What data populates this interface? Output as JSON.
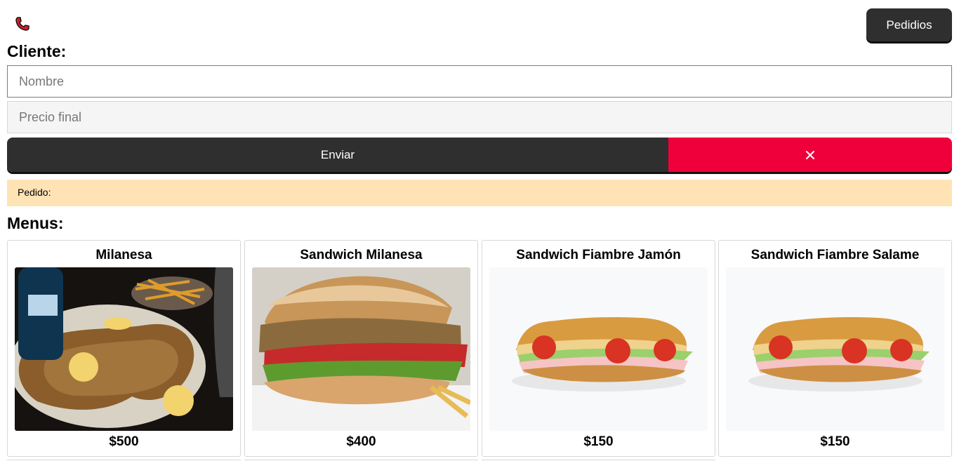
{
  "header": {
    "phone_icon": "phone-icon",
    "orders_label": "Pedidios"
  },
  "client": {
    "title": "Cliente:",
    "name_placeholder": "Nombre",
    "price_placeholder": "Precio final",
    "send_label": "Enviar",
    "clear_icon": "close-icon",
    "order_label": "Pedido:"
  },
  "menu": {
    "title": "Menus:",
    "items": [
      {
        "name": "Milanesa",
        "price": "$500",
        "image": "milanesa-photo"
      },
      {
        "name": "Sandwich Milanesa",
        "price": "$400",
        "image": "milanesa-sandwich-photo"
      },
      {
        "name": "Sandwich Fiambre Jamón",
        "price": "$150",
        "image": "ham-sandwich-photo"
      },
      {
        "name": "Sandwich Fiambre Salame",
        "price": "$150",
        "image": "salami-sandwich-photo"
      }
    ]
  },
  "colors": {
    "dark_button": "#2f2f2f",
    "danger": "#f0003a",
    "order_bar": "#ffe3b4"
  }
}
